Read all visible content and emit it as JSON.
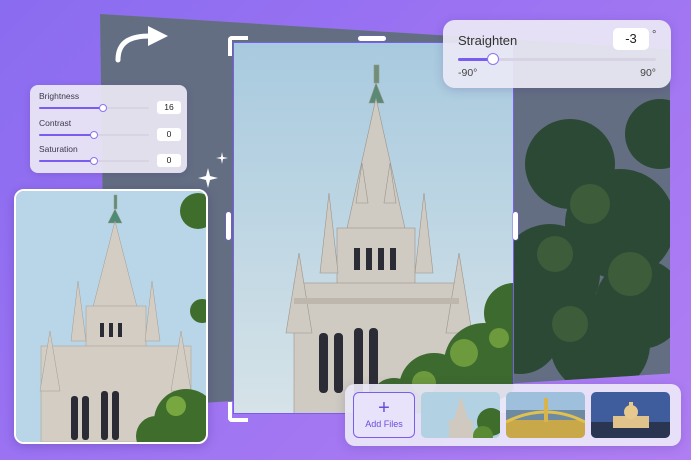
{
  "adjust": {
    "items": [
      {
        "label": "Brightness",
        "value": "16",
        "level": 0.45
      },
      {
        "label": "Contrast",
        "value": "0",
        "level": 0.39
      },
      {
        "label": "Saturation",
        "value": "0",
        "level": 0.39
      }
    ]
  },
  "straighten": {
    "title": "Straighten",
    "value": "-3",
    "unit": "°",
    "min_label": "-90°",
    "max_label": "90°",
    "level": 0.15
  },
  "thumbbar": {
    "add_label": "Add Files",
    "add_icon": "plus-icon",
    "thumbs": [
      "cathedral-thumbnail",
      "bridge-thumbnail",
      "capitol-thumbnail"
    ]
  },
  "colors": {
    "accent": "#7a5cf0",
    "background": "#9a72f2"
  },
  "icons": [
    "rotate-arrow-icon",
    "sparkle-icon"
  ]
}
